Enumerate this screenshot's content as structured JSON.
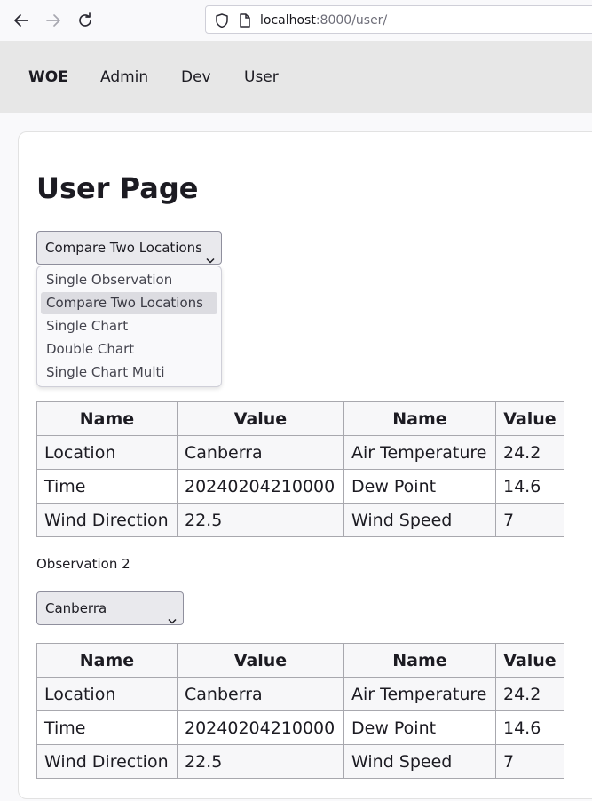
{
  "browser": {
    "url_host": "localhost",
    "url_rest": ":8000/user/"
  },
  "nav": {
    "brand": "WOE",
    "links": [
      "Admin",
      "Dev",
      "User"
    ]
  },
  "page": {
    "title": "User Page"
  },
  "view_select": {
    "selected": "Compare Two Locations",
    "options": [
      "Single Observation",
      "Compare Two Locations",
      "Single Chart",
      "Double Chart",
      "Single Chart Multi"
    ]
  },
  "table_headers": [
    "Name",
    "Value",
    "Name",
    "Value"
  ],
  "observation1": {
    "rows": [
      [
        "Location",
        "Canberra",
        "Air Temperature",
        "24.2"
      ],
      [
        "Time",
        "20240204210000",
        "Dew Point",
        "14.6"
      ],
      [
        "Wind Direction",
        "22.5",
        "Wind Speed",
        "7"
      ]
    ]
  },
  "observation2": {
    "label": "Observation 2",
    "location_select": "Canberra",
    "rows": [
      [
        "Location",
        "Canberra",
        "Air Temperature",
        "24.2"
      ],
      [
        "Time",
        "20240204210000",
        "Dew Point",
        "14.6"
      ],
      [
        "Wind Direction",
        "22.5",
        "Wind Speed",
        "7"
      ]
    ]
  }
}
